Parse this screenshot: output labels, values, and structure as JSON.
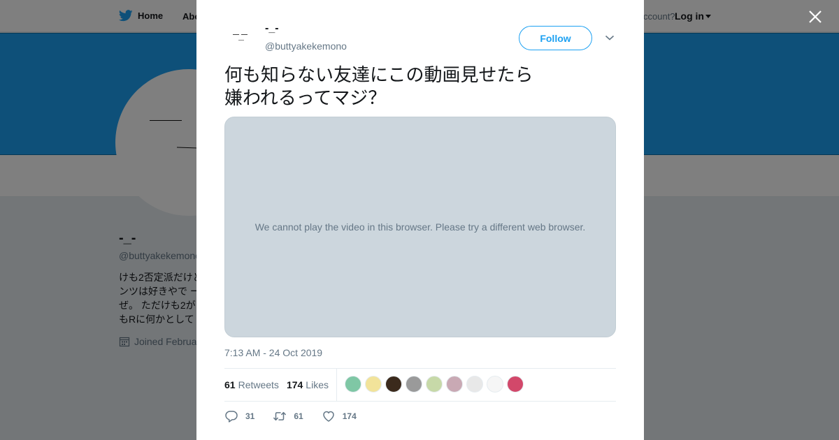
{
  "nav": {
    "home_label": "Home",
    "about_label": "Abo",
    "account_prompt": "ccount?",
    "login_label": "Log in"
  },
  "profile_bg": {
    "name": "-_-",
    "handle": "@buttyakekemono",
    "bio_lines": [
      "けも2否定派だけど",
      "ンツは好きやで ー",
      "ぜ。 ただけも2が",
      "もRに何かとして"
    ],
    "joined_label": "Joined Februa"
  },
  "tweet": {
    "author_name": "-_-",
    "author_handle": "@buttyakekemono",
    "follow_label": "Follow",
    "text": "何も知らない友達にこの動画見せたら嫌われるってマジ？",
    "video_message": "We cannot play the video in this browser. Please try a different web browser.",
    "timestamp": "7:13 AM - 24 Oct 2019",
    "retweets_count": "61",
    "retweets_label": "Retweets",
    "likes_count": "174",
    "likes_label": "Likes",
    "likers": [
      {
        "name": "liker-1",
        "color": "#7fc7a5"
      },
      {
        "name": "liker-2",
        "color": "#f2e39a"
      },
      {
        "name": "liker-3",
        "color": "#3b2a1c"
      },
      {
        "name": "liker-4",
        "color": "#9a9a9a"
      },
      {
        "name": "liker-5",
        "color": "#c7d9a8"
      },
      {
        "name": "liker-6",
        "color": "#c9a9b4"
      },
      {
        "name": "liker-7",
        "color": "#e8e8e8"
      },
      {
        "name": "liker-8",
        "color": "#f6f6f6"
      },
      {
        "name": "liker-9",
        "color": "#d2486a"
      }
    ],
    "actions": {
      "reply_count": "31",
      "retweet_count": "61",
      "like_count": "174"
    }
  },
  "colors": {
    "accent": "#1da1f2",
    "banner": "#1da1f2",
    "muted": "#657786",
    "video_bg": "#ccd6dd"
  }
}
